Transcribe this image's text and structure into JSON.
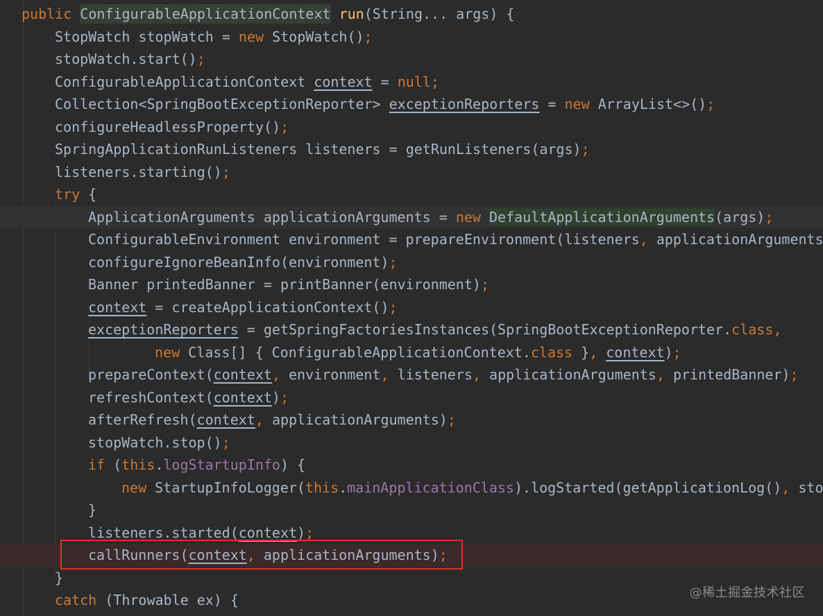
{
  "watermark": "@稀土掘金技术社区",
  "code": {
    "l1": {
      "kw": "public ",
      "hl": "ConfigurableApplicationContext",
      "fn": " run",
      "rest": "(String... args) {"
    },
    "l2": {
      "t1": "StopWatch stopWatch = ",
      "kw": "new ",
      "t2": "StopWatch()",
      "semi": ";"
    },
    "l3": {
      "t1": "stopWatch.start()",
      "semi": ";"
    },
    "l4": {
      "t1": "ConfigurableApplicationContext ",
      "ul": "context",
      "t2": " = ",
      "kw": "null",
      "semi": ";"
    },
    "l5": {
      "t1": "Collection<SpringBootExceptionReporter> ",
      "ul": "exceptionReporters",
      "t2": " = ",
      "kw": "new ",
      "t3": "ArrayList<>()",
      "semi": ";"
    },
    "l6": {
      "t1": "configureHeadlessProperty()",
      "semi": ";"
    },
    "l7": {
      "t1": "SpringApplicationRunListeners listeners = getRunListeners(args)",
      "semi": ";"
    },
    "l8": {
      "t1": "listeners.starting()",
      "semi": ";"
    },
    "l9": {
      "kw": "try ",
      "t1": "{"
    },
    "l10": {
      "t1": "ApplicationArguments applicationArguments = ",
      "kw": "new ",
      "hl": "DefaultApplicationArguments",
      "t2": "(args)",
      "semi": ";"
    },
    "l11": {
      "t1": "ConfigurableEnvironment environment = prepareEnvironment(listeners",
      "comma": ", ",
      "t2": "applicationArguments)"
    },
    "l12": {
      "t1": "configureIgnoreBeanInfo(environment)",
      "semi": ";"
    },
    "l13": {
      "t1": "Banner printedBanner = printBanner(environment)",
      "semi": ";"
    },
    "l14": {
      "ul": "context",
      "t1": " = createApplicationContext()",
      "semi": ";"
    },
    "l15": {
      "ul": "exceptionReporters",
      "t1": " = getSpringFactoriesInstances(SpringBootExceptionReporter.",
      "kw": "class",
      "comma": ","
    },
    "l16": {
      "kw1": "new ",
      "t1": "Class[] { ConfigurableApplicationContext.",
      "kw2": "class",
      "t2": " }",
      "comma": ", ",
      "ul": "context",
      "t3": ")",
      "semi": ";"
    },
    "l17": {
      "t1": "prepareContext(",
      "ul": "context",
      "c1": ", ",
      "t2": "environment",
      "c2": ", ",
      "t3": "listeners",
      "c3": ", ",
      "t4": "applicationArguments",
      "c4": ", ",
      "t5": "printedBanner)",
      "semi": ";"
    },
    "l18": {
      "t1": "refreshContext(",
      "ul": "context",
      "t2": ")",
      "semi": ";"
    },
    "l19": {
      "t1": "afterRefresh(",
      "ul": "context",
      "c1": ", ",
      "t2": "applicationArguments)",
      "semi": ";"
    },
    "l20": {
      "t1": "stopWatch.stop()",
      "semi": ";"
    },
    "l21": {
      "kw1": "if ",
      "t1": "(",
      "kw2": "this",
      "t2": ".",
      "fld": "logStartupInfo",
      "t3": ") {"
    },
    "l22": {
      "kw1": "new ",
      "t1": "StartupInfoLogger(",
      "kw2": "this",
      "t2": ".",
      "fld": "mainApplicationClass",
      "t3": ").logStarted(getApplicationLog()",
      "c1": ", ",
      "t4": "stop"
    },
    "l23": {
      "t1": "}"
    },
    "l24": {
      "t1": "listeners.started(",
      "ul": "context",
      "t2": ")",
      "semi": ";"
    },
    "l25": {
      "t1": "callRunners(",
      "ul": "context",
      "c1": ", ",
      "t2": "applicationArguments)",
      "semi": ";"
    },
    "l26": {
      "t1": "}"
    },
    "l27": {
      "kw": "catch ",
      "t1": "(Throwable ex) {"
    }
  }
}
